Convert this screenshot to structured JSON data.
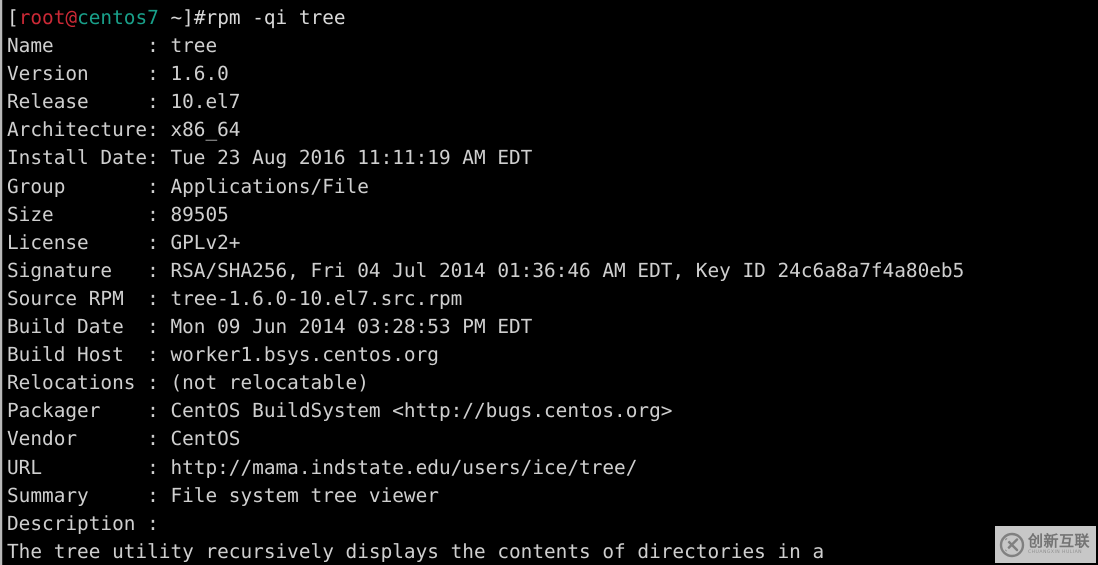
{
  "terminal": {
    "background_color": "#000000",
    "foreground_color": "#cfcfcf",
    "prompt": {
      "open_bracket": "[",
      "user": "root",
      "at": "@",
      "host": "centos7",
      "path": " ~]#",
      "user_color": "#cc2936",
      "host_color": "#19a08a",
      "command": "rpm -qi tree"
    },
    "lines": [
      "Name        : tree",
      "Version     : 1.6.0",
      "Release     : 10.el7",
      "Architecture: x86_64",
      "Install Date: Tue 23 Aug 2016 11:11:19 AM EDT",
      "Group       : Applications/File",
      "Size        : 89505",
      "License     : GPLv2+",
      "Signature   : RSA/SHA256, Fri 04 Jul 2014 01:36:46 AM EDT, Key ID 24c6a8a7f4a80eb5",
      "Source RPM  : tree-1.6.0-10.el7.src.rpm",
      "Build Date  : Mon 09 Jun 2014 03:28:53 PM EDT",
      "Build Host  : worker1.bsys.centos.org",
      "Relocations : (not relocatable)",
      "Packager    : CentOS BuildSystem <http://bugs.centos.org>",
      "Vendor      : CentOS",
      "URL         : http://mama.indstate.edu/users/ice/tree/",
      "Summary     : File system tree viewer",
      "Description :",
      "The tree utility recursively displays the contents of directories in a"
    ],
    "rpm_fields": [
      {
        "label": "Name",
        "value": "tree"
      },
      {
        "label": "Version",
        "value": "1.6.0"
      },
      {
        "label": "Release",
        "value": "10.el7"
      },
      {
        "label": "Architecture",
        "value": "x86_64"
      },
      {
        "label": "Install Date",
        "value": "Tue 23 Aug 2016 11:11:19 AM EDT"
      },
      {
        "label": "Group",
        "value": "Applications/File"
      },
      {
        "label": "Size",
        "value": "89505"
      },
      {
        "label": "License",
        "value": "GPLv2+"
      },
      {
        "label": "Signature",
        "value": "RSA/SHA256, Fri 04 Jul 2014 01:36:46 AM EDT, Key ID 24c6a8a7f4a80eb5"
      },
      {
        "label": "Source RPM",
        "value": "tree-1.6.0-10.el7.src.rpm"
      },
      {
        "label": "Build Date",
        "value": "Mon 09 Jun 2014 03:28:53 PM EDT"
      },
      {
        "label": "Build Host",
        "value": "worker1.bsys.centos.org"
      },
      {
        "label": "Relocations",
        "value": "(not relocatable)"
      },
      {
        "label": "Packager",
        "value": "CentOS BuildSystem <http://bugs.centos.org>"
      },
      {
        "label": "Vendor",
        "value": "CentOS"
      },
      {
        "label": "URL",
        "value": "http://mama.indstate.edu/users/ice/tree/"
      },
      {
        "label": "Summary",
        "value": "File system tree viewer"
      },
      {
        "label": "Description",
        "value": ""
      }
    ],
    "description_text": "The tree utility recursively displays the contents of directories in a"
  },
  "watermark": {
    "logo_icon": "circle-x-logo-icon",
    "chinese_text": "创新互联",
    "english_text": "CHUANGXIN HULIAN"
  }
}
